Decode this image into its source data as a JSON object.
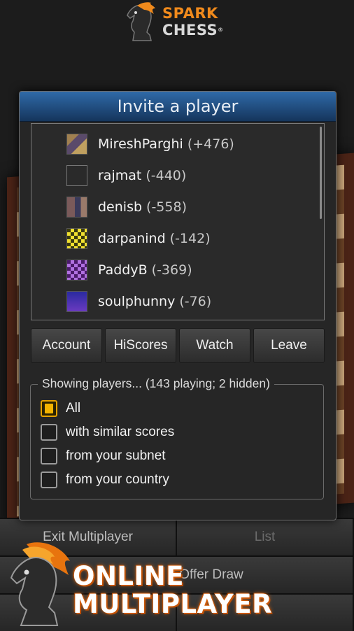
{
  "brand": {
    "spark": "SPARK",
    "chess": "CHESS",
    "reg": "®"
  },
  "dialog": {
    "title": "Invite a player",
    "players": [
      {
        "name": "MireshParghi",
        "score": "(+476)",
        "avatar_color": "#8a6a3a"
      },
      {
        "name": "rajmat",
        "score": "(-440)",
        "avatar_color": "#2a2a2a"
      },
      {
        "name": "denisb",
        "score": "(-558)",
        "avatar_color": "#6a4a4a"
      },
      {
        "name": "darpanind",
        "score": "(-142)",
        "avatar_color": "#e0d020"
      },
      {
        "name": "PaddyB",
        "score": "(-369)",
        "avatar_color": "#7a3aa0"
      },
      {
        "name": "soulphunny",
        "score": "(-76)",
        "avatar_color": "#2a2a8a"
      }
    ],
    "buttons": [
      "Account",
      "HiScores",
      "Watch",
      "Leave"
    ],
    "filter": {
      "legend": "Showing players... (143 playing; 2 hidden)",
      "options": [
        {
          "label": "All",
          "checked": true
        },
        {
          "label": "with similar scores",
          "checked": false
        },
        {
          "label": "from your subnet",
          "checked": false
        },
        {
          "label": "from your country",
          "checked": false
        }
      ]
    }
  },
  "background": {
    "exit_multiplayer": "Exit Multiplayer",
    "list": "List",
    "draw": "Offer Draw"
  },
  "promo": {
    "line1": "ONLINE",
    "line2": "MULTIPLAYER"
  },
  "colors": {
    "accent": "#f08a1c",
    "title_bar": "#2f6aa8",
    "checkbox_checked": "#f4b400"
  }
}
